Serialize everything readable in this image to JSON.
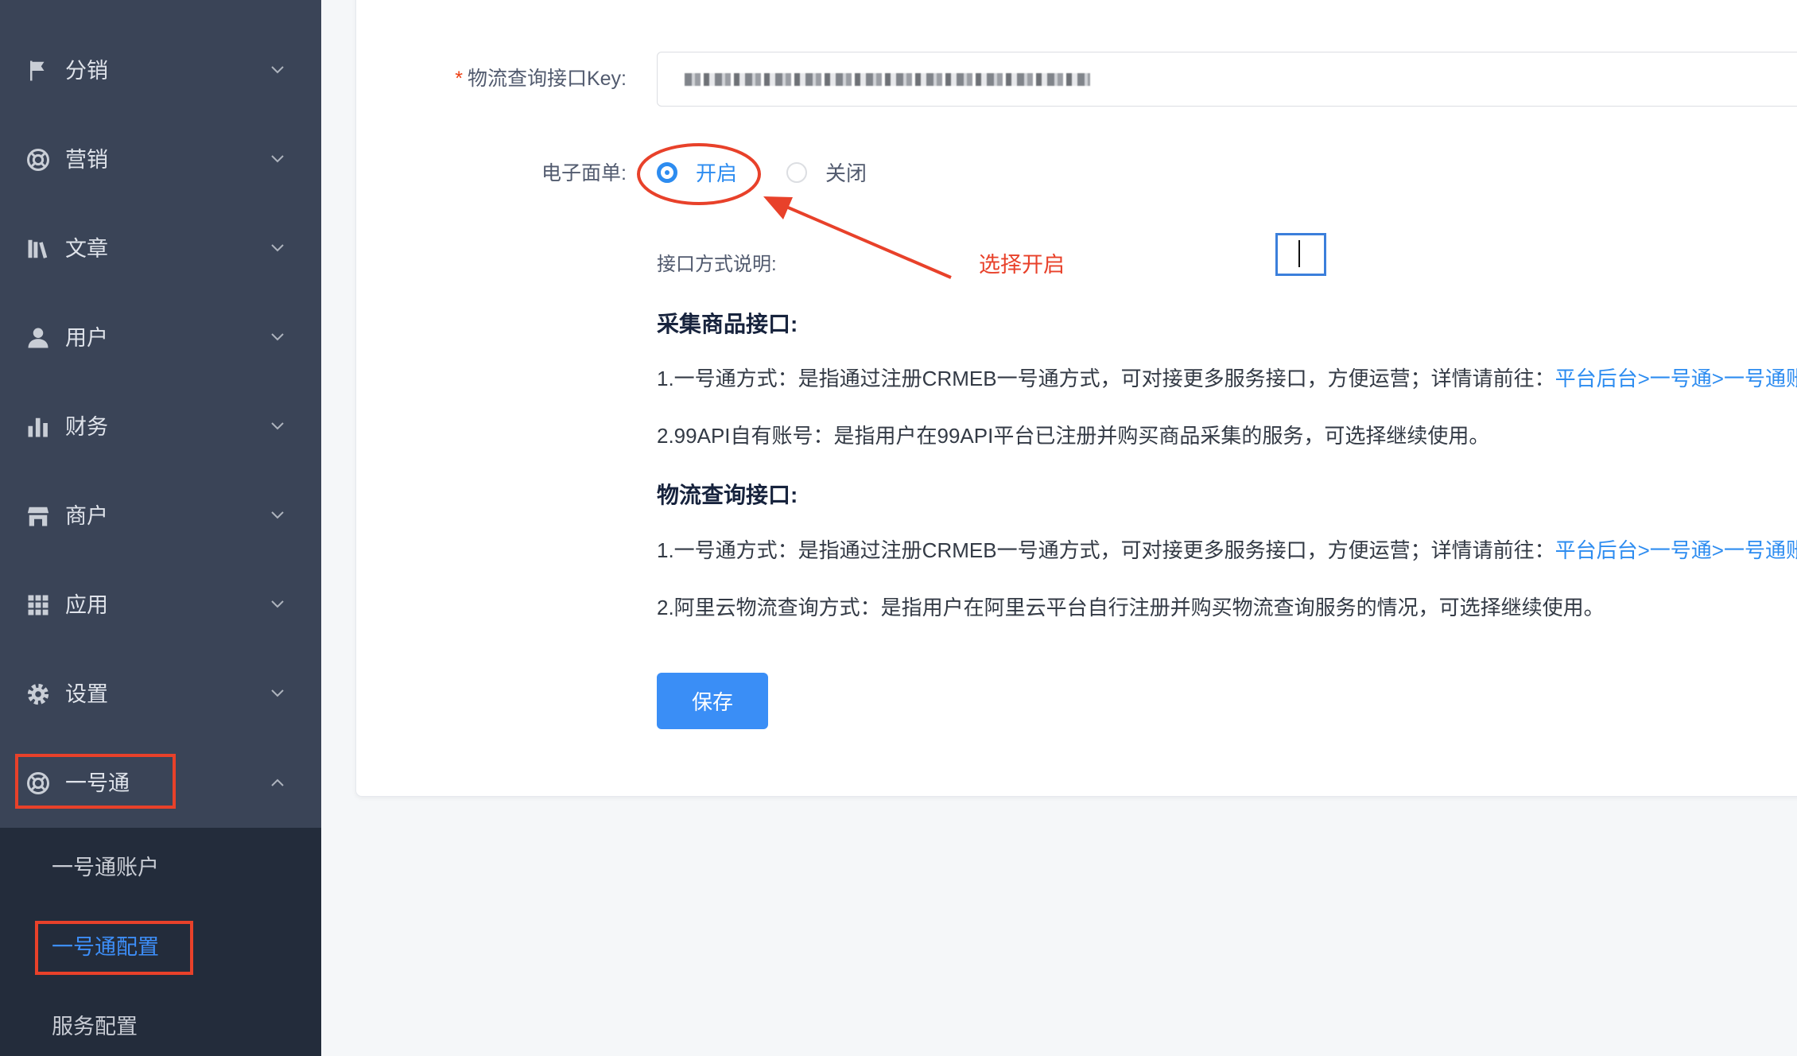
{
  "sidebar": {
    "items": [
      {
        "label": "分销",
        "icon": "flag-icon",
        "expanded": false
      },
      {
        "label": "营销",
        "icon": "lifebuoy-icon",
        "expanded": false
      },
      {
        "label": "文章",
        "icon": "library-icon",
        "expanded": false
      },
      {
        "label": "用户",
        "icon": "user-icon",
        "expanded": false
      },
      {
        "label": "财务",
        "icon": "bar-chart-icon",
        "expanded": false
      },
      {
        "label": "商户",
        "icon": "store-icon",
        "expanded": false
      },
      {
        "label": "应用",
        "icon": "grid-icon",
        "expanded": false
      },
      {
        "label": "设置",
        "icon": "gear-icon",
        "expanded": false
      },
      {
        "label": "一号通",
        "icon": "lifebuoy-icon",
        "expanded": true
      }
    ],
    "submenu": [
      {
        "label": "一号通账户",
        "active": false
      },
      {
        "label": "一号通配置",
        "active": true
      },
      {
        "label": "服务配置",
        "active": false
      }
    ]
  },
  "form": {
    "required_mark": "*",
    "key_label": "物流查询接口Key:",
    "key_value": "",
    "waybill_label": "电子面单:",
    "waybill_options": [
      {
        "label": "开启",
        "selected": true
      },
      {
        "label": "关闭",
        "selected": false
      }
    ]
  },
  "notes": {
    "title": "接口方式说明:",
    "sections": [
      {
        "heading": "采集商品接口:",
        "lines": [
          {
            "text": "1.一号通方式：是指通过注册CRMEB一号通方式，可对接更多服务接口，方便运营；详情请前往：",
            "link": "平台后台>一号通>一号通账"
          },
          {
            "text": "2.99API自有账号：是指用户在99API平台已注册并购买商品采集的服务，可选择继续使用。"
          }
        ]
      },
      {
        "heading": "物流查询接口:",
        "lines": [
          {
            "text": "1.一号通方式：是指通过注册CRMEB一号通方式，可对接更多服务接口，方便运营；详情请前往：",
            "link": "平台后台>一号通>一号通账"
          },
          {
            "text": "2.阿里云物流查询方式：是指用户在阿里云平台自行注册并购买物流查询服务的情况，可选择继续使用。"
          }
        ]
      }
    ]
  },
  "save_label": "保存",
  "annotation": {
    "text": "选择开启"
  },
  "colors": {
    "accent": "#2d8cf0",
    "annotation_red": "#e8412a",
    "sidebar_bg": "#3a4457",
    "submenu_bg": "#232c3b",
    "button_bg": "#3a8ef6"
  }
}
